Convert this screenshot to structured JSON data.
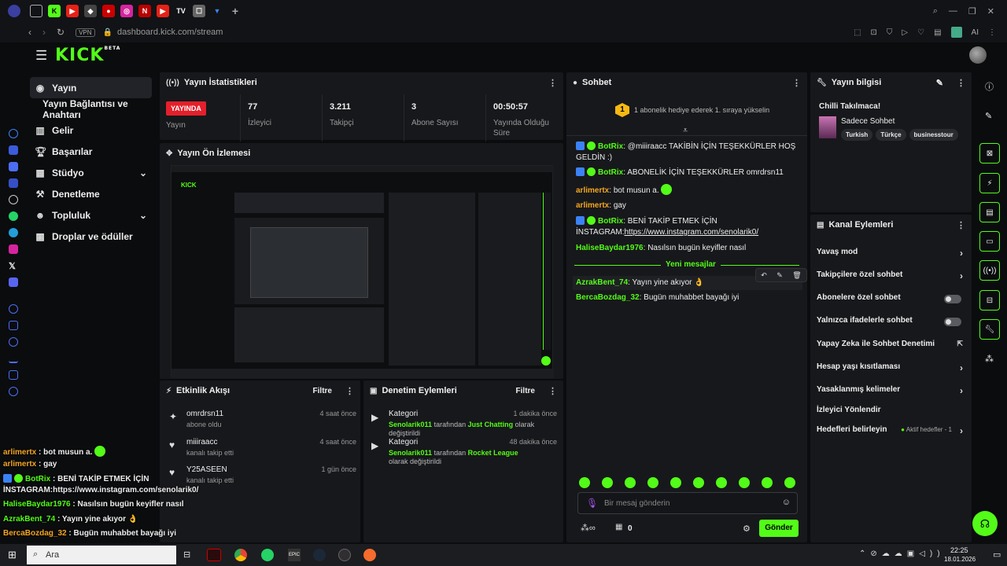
{
  "browser": {
    "url": "dashboard.kick.com/stream",
    "vpn": "VPN",
    "ai_label": "AI"
  },
  "brand": {
    "logo": "KICK",
    "beta": "BETA",
    "accent": "#53fc18"
  },
  "nav": {
    "items": [
      {
        "label": "Yayın",
        "icon": "broadcast-icon"
      },
      {
        "label": "Yayın Bağlantısı ve Anahtarı",
        "icon": ""
      },
      {
        "label": "Gelir",
        "icon": "revenue-icon"
      },
      {
        "label": "Başarılar",
        "icon": "trophy-icon"
      },
      {
        "label": "Stüdyo",
        "icon": "studio-icon"
      },
      {
        "label": "Denetleme",
        "icon": "moderation-icon"
      },
      {
        "label": "Topluluk",
        "icon": "community-icon"
      },
      {
        "label": "Droplar ve ödüller",
        "icon": "drops-icon"
      }
    ]
  },
  "stats": {
    "title": "Yayın İstatistikleri",
    "live_badge": "YAYINDA",
    "live_label": "Yayın",
    "viewers": "77",
    "viewers_label": "İzleyici",
    "followers": "3.211",
    "followers_label": "Takipçi",
    "subs": "3",
    "subs_label": "Abone Sayısı",
    "duration": "00:50:57",
    "duration_label": "Yayında Olduğu Süre"
  },
  "preview": {
    "title": "Yayın Ön İzlemesi"
  },
  "activity": {
    "title": "Etkinlik Akışı",
    "filter": "Filtre",
    "items": [
      {
        "name": "omrdrsn11",
        "sub": "abone oldu",
        "time": "4 saat önce"
      },
      {
        "name": "miiiraacc",
        "sub": "kanalı takip etti",
        "time": "4 saat önce"
      },
      {
        "name": "Y25ASEEN",
        "sub": "kanalı takip etti",
        "time": "1 gün önce"
      }
    ]
  },
  "moderation": {
    "title": "Denetim Eylemleri",
    "filter": "Filtre",
    "items": [
      {
        "title": "Kategori",
        "time": "1 dakika önce",
        "user": "Senolarik011",
        "mid": "tarafından",
        "cat": "Just Chatting",
        "end": "olarak değiştirildi"
      },
      {
        "title": "Kategori",
        "time": "48 dakika önce",
        "user": "Senolarik011",
        "mid": "tarafından",
        "cat": "Rocket League",
        "end": "olarak değiştirildi"
      }
    ]
  },
  "chat": {
    "title": "Sohbet",
    "gift_rank": "1",
    "gift_text": "1 abonelik hediye ederek 1. sıraya yükselin",
    "messages": [
      {
        "user": "BotRix",
        "text": "@miiiraacc TAKİBİN İÇİN TEŞEKKÜRLER HOŞ GELDİN :)"
      },
      {
        "user": "BotRix",
        "text": "ABONELİK İÇİN TEŞEKKÜRLER omrdrsn11"
      },
      {
        "user": "arlimertx",
        "text": "bot musun a."
      },
      {
        "user": "arlimertx",
        "text": "gay"
      },
      {
        "user": "BotRix",
        "text": "BENİ TAKİP ETMEK İÇİN İNSTAGRAM:",
        "link": "https://www.instagram.com/senolarik0/"
      },
      {
        "user": "HaliseBaydar1976",
        "text": "Nasılsın bugün keyifler nasıl"
      },
      {
        "user": "AzrakBent_74",
        "text": "Yayın yine akıyor 👌"
      },
      {
        "user": "BercaBozdag_32",
        "text": "Bugün muhabbet bayağı iyi"
      }
    ],
    "new_messages": "Yeni mesajlar",
    "input_placeholder": "Bir mesaj gönderin",
    "points": "0",
    "send": "Gönder"
  },
  "info": {
    "title": "Yayın bilgisi",
    "stream_title": "Chilli Takılmaca!",
    "category": "Sadece Sohbet",
    "tags": [
      "Turkish",
      "Türkçe",
      "businesstour"
    ]
  },
  "actions": {
    "title": "Kanal Eylemleri",
    "items": [
      {
        "label": "Yavaş mod",
        "type": "chevron"
      },
      {
        "label": "Takipçilere özel sohbet",
        "type": "chevron"
      },
      {
        "label": "Abonelere özel sohbet",
        "type": "toggle"
      },
      {
        "label": "Yalnızca ifadelerle sohbet",
        "type": "toggle"
      },
      {
        "label": "Yapay Zeka ile Sohbet Denetimi",
        "type": "external"
      },
      {
        "label": "Hesap yaşı kısıtlaması",
        "type": "chevron"
      },
      {
        "label": "Yasaklanmış kelimeler",
        "type": "chevron"
      },
      {
        "label": "İzleyici Yönlendir",
        "type": "none"
      },
      {
        "label": "Hedefleri belirleyin",
        "type": "goals",
        "extra": "Aktif hedefler - 1"
      }
    ]
  },
  "overlay_chat": [
    {
      "user": "arlimertx",
      "text": ": bot musun a.",
      "color": "#f5a623"
    },
    {
      "user": "arlimertx",
      "text": ": gay",
      "color": "#f5a623"
    },
    {
      "user": "BotRix",
      "text": ": BENİ TAKİP ETMEK İÇİN",
      "color": "#53fc18"
    },
    {
      "user": "",
      "text": "İNSTAGRAM:https://www.instagram.com/senolarik0/",
      "color": "#53fc18"
    },
    {
      "user": "HaliseBaydar1976",
      "text": ": Nasılsın bugün keyifler nasıl",
      "color": "#53fc18"
    },
    {
      "user": "AzrakBent_74",
      "text": ": Yayın yine akıyor 👌",
      "color": "#53fc18"
    },
    {
      "user": "BercaBozdag_32",
      "text": ": Bugün muhabbet bayağı iyi",
      "color": "#f5a623"
    }
  ],
  "taskbar": {
    "search": "Ara",
    "time": "22:25",
    "date": "18.01.2026"
  }
}
